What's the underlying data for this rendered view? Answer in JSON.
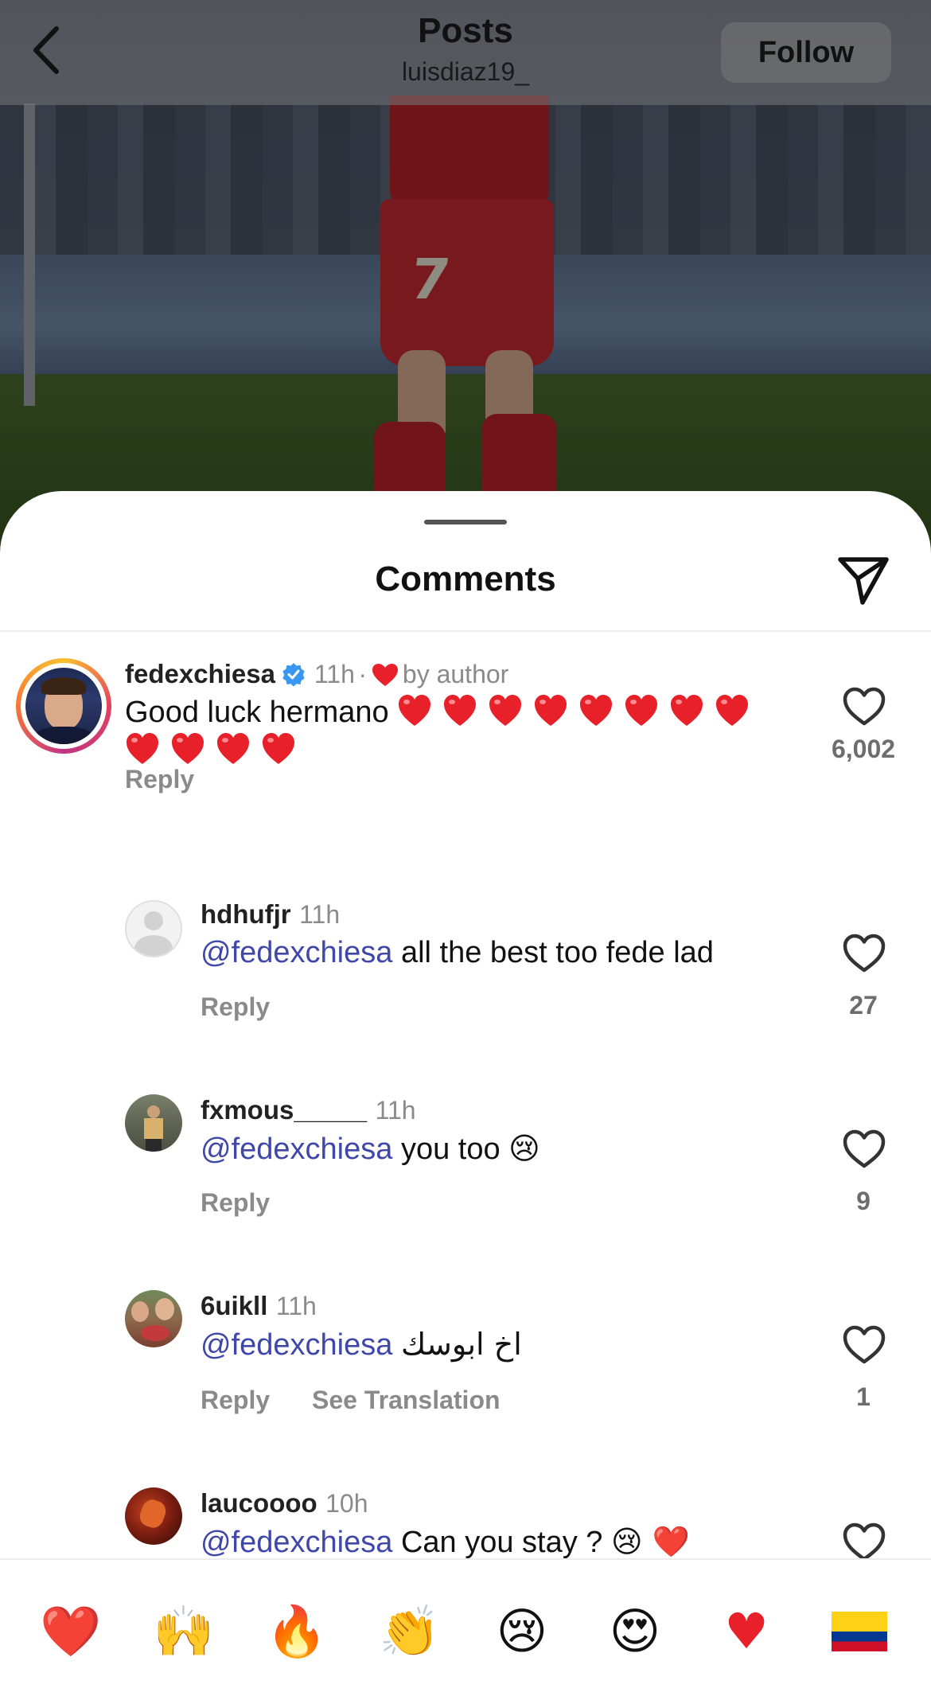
{
  "header": {
    "title": "Posts",
    "subtitle": "luisdiaz19_",
    "follow_label": "Follow",
    "back_icon": "chevron-left-icon"
  },
  "sheet": {
    "title": "Comments",
    "share_icon": "paper-plane-icon"
  },
  "comments": [
    {
      "username": "fedexchiesa",
      "verified": true,
      "time": "11h",
      "separator": "·",
      "liked_by": "by author",
      "text": "Good luck hermano",
      "hearts_count": 12,
      "reply_label": "Reply",
      "likes": "6,002"
    },
    {
      "username": "hdhufjr",
      "time": "11h",
      "mention": "@fedexchiesa",
      "text": "all the best too fede lad",
      "reply_label": "Reply",
      "likes": "27"
    },
    {
      "username": "fxmous_____",
      "time": "11h",
      "mention": "@fedexchiesa",
      "text": "you too",
      "emoji": "😢",
      "reply_label": "Reply",
      "likes": "9"
    },
    {
      "username": "6uikll",
      "time": "11h",
      "mention": "@fedexchiesa",
      "text": "اخ ابوسك",
      "reply_label": "Reply",
      "translate_label": "See Translation",
      "likes": "1"
    },
    {
      "username": "laucoooo",
      "time": "10h",
      "mention": "@fedexchiesa",
      "text": "Can you stay ?",
      "emoji": "😢 ❤️"
    }
  ],
  "emoji_bar": [
    "❤️",
    "🙌",
    "🔥",
    "👏",
    "😢",
    "😍",
    "♥",
    "🇨🇴"
  ],
  "colors": {
    "mention": "#3f47a8",
    "heart_red": "#e8202a",
    "verified_blue": "#3897f0",
    "muted": "#8a8a8a"
  }
}
